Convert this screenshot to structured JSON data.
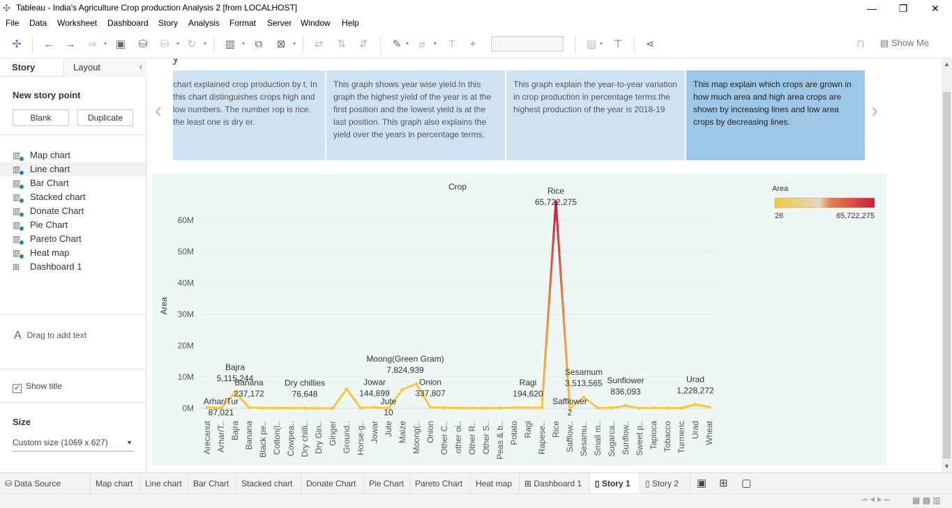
{
  "window": {
    "title": "Tableau - India's Agriculture Crop production Analysis 2 [from LOCALHOST]",
    "minimize": "—",
    "restore": "❐",
    "close": "✕"
  },
  "menu": [
    "File",
    "Data",
    "Worksheet",
    "Dashboard",
    "Story",
    "Analysis",
    "Format",
    "Server",
    "Window",
    "Help"
  ],
  "toolbar": {
    "show_me": "Show Me"
  },
  "left_panel": {
    "tab_story": "Story",
    "tab_layout": "Layout",
    "new_story_point": "New story point",
    "blank": "Blank",
    "duplicate": "Duplicate",
    "sheets": [
      {
        "label": "Map chart",
        "type": "worksheet"
      },
      {
        "label": "Line chart",
        "type": "worksheet",
        "selected": true
      },
      {
        "label": "Bar Chart",
        "type": "worksheet"
      },
      {
        "label": "Stacked chart",
        "type": "worksheet"
      },
      {
        "label": "Donate Chart",
        "type": "worksheet"
      },
      {
        "label": "Pie Chart",
        "type": "worksheet"
      },
      {
        "label": "Pareto Chart",
        "type": "worksheet"
      },
      {
        "label": "Heat map",
        "type": "worksheet"
      },
      {
        "label": "Dashboard 1",
        "type": "dashboard"
      }
    ],
    "drag_text": "Drag to add text",
    "show_title": "Show title",
    "size_heading": "Size",
    "size_value": "Custom size (1069 x 627)"
  },
  "story": {
    "title_fragment": "y",
    "points": [
      "chart explained crop production by t. In this chart distinguishes crops high and low numbers. The number rop is rice. the least one is dry er.",
      "This graph shows year wise yield.In this graph the highest yield of the year is at the first position and the lowest yield is at the last position. This graph also explains the yield over the years in percentage terms.",
      "This graph explain the year-to-year variation in crop production in percentage terms.the highest production of the year is 2018-19",
      "This map explain which crops are grown in how much area and high area crops are shown by increasing lines and low area crops by decreasing lines."
    ]
  },
  "chart_data": {
    "type": "line",
    "title": "Crop",
    "ylabel": "Area",
    "ylim": [
      0,
      65722275
    ],
    "yticks": [
      "0M",
      "10M",
      "20M",
      "30M",
      "40M",
      "50M",
      "60M"
    ],
    "legend": {
      "title": "Area",
      "min": "26",
      "max": "65,722,275",
      "colors": [
        "#f5c842",
        "#e0d9c0",
        "#e8844a",
        "#c8203a"
      ]
    },
    "categories": [
      "Arecanut",
      "Arhar/T..",
      "Bajra",
      "Banana",
      "Black pe..",
      "Cotton(l..",
      "Cowpea..",
      "Dry chilli..",
      "Dry Gin..",
      "Ginger",
      "Ground..",
      "Horse-g..",
      "Jowar",
      "Jute",
      "Maize",
      "Moong(..",
      "Onion",
      "Other C..",
      "other oi..",
      "Other R..",
      "Other S..",
      "Peas & b..",
      "Potato",
      "Ragi",
      "Rapese..",
      "Rice",
      "Safflow..",
      "Sesamu..",
      "Small m..",
      "Sugarca..",
      "Sunflow..",
      "Sweet p..",
      "Tapioca",
      "Tobacco",
      "Turmeric",
      "Urad",
      "Wheat"
    ],
    "values": [
      250000,
      87021,
      5115244,
      237172,
      120000,
      90000,
      110000,
      76648,
      40000,
      20000,
      6200000,
      144899,
      300000,
      10,
      6000000,
      7824939,
      337807,
      150000,
      100000,
      90000,
      80000,
      120000,
      200000,
      194620,
      210000,
      65722275,
      2,
      3513565,
      120000,
      140000,
      836093,
      60000,
      130000,
      90000,
      70000,
      1228272,
      400000
    ],
    "labels": [
      {
        "lines": [
          "Arhar/Tur",
          "87,021"
        ],
        "cat": 1,
        "dy": -12
      },
      {
        "lines": [
          "Bajra",
          "5,115,244"
        ],
        "cat": 2,
        "dy": -32
      },
      {
        "lines": [
          "Banana",
          "237,172"
        ],
        "cat": 3,
        "dy": -32
      },
      {
        "lines": [
          "Dry chillies",
          "76,648"
        ],
        "cat": 7,
        "dy": -32
      },
      {
        "lines": [
          "Moong(Green Gram)",
          "7,824,939"
        ],
        "cat": 14,
        "dy": -32
      },
      {
        "lines": [
          "Jowar",
          "144,899"
        ],
        "cat": 12,
        "dy": -32
      },
      {
        "lines": [
          "Jute",
          "10"
        ],
        "cat": 13,
        "dy": -12
      },
      {
        "lines": [
          "Onion",
          "337,807"
        ],
        "cat": 16,
        "dy": -32
      },
      {
        "lines": [
          "Ragi",
          "194,620"
        ],
        "cat": 23,
        "dy": -32
      },
      {
        "lines": [
          "Rice",
          "65,722,275"
        ],
        "cat": 25,
        "dy": -12
      },
      {
        "lines": [
          "Safflower",
          "2"
        ],
        "cat": 26,
        "dy": -12
      },
      {
        "lines": [
          "Sesamum",
          "3,513,565"
        ],
        "cat": 27,
        "dy": -32
      },
      {
        "lines": [
          "Sunflower",
          "836,093"
        ],
        "cat": 30,
        "dy": -32
      },
      {
        "lines": [
          "Urad",
          "1,228,272"
        ],
        "cat": 35,
        "dy": -32
      }
    ]
  },
  "bottom_tabs": [
    "Data Source",
    "Map chart",
    "Line chart",
    "Bar Chart",
    "Stacked chart",
    "Donate Chart",
    "Pie Chart",
    "Pareto Chart",
    "Heat map",
    "Dashboard 1",
    "Story 1",
    "Story 2"
  ],
  "active_tab": "Story 1"
}
